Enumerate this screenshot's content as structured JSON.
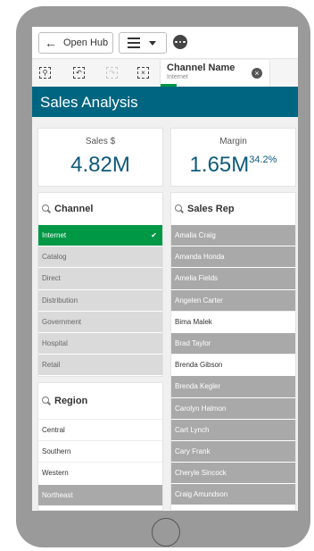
{
  "toolbar": {
    "open_hub": "Open Hub",
    "arrow_icon": "arrow-left-icon",
    "menu_icon": "hamburger-icon"
  },
  "selection": {
    "field": "Channel Name",
    "value": "Internet"
  },
  "sheet": {
    "title": "Sales Analysis"
  },
  "kpis": [
    {
      "label": "Sales $",
      "value": "4.82M"
    },
    {
      "label": "Margin",
      "value": "1.65M",
      "suffix": "34.2%"
    }
  ],
  "channel": {
    "title": "Channel",
    "items": [
      "Internet",
      "Catalog",
      "Direct",
      "Distribution",
      "Government",
      "Hospital",
      "Retail"
    ]
  },
  "region": {
    "title": "Region",
    "items": [
      "Central",
      "Southern",
      "Western",
      "Northeast"
    ]
  },
  "salesrep": {
    "title": "Sales Rep",
    "items": [
      "Amalia Craig",
      "Amanda Honda",
      "Amelia Fields",
      "Angelen Carter",
      "Bima Malek",
      "Brad Taylor",
      "Brenda Gibson",
      "Brenda Kegler",
      "Carolyn Halmon",
      "Cart Lynch",
      "Cary Frank",
      "Cheryle Sincock",
      "Craig Amundson"
    ]
  },
  "colors": {
    "accent": "#006580",
    "selected": "#009845",
    "excluded": "#a9a9a9",
    "alternative": "#dadada"
  }
}
